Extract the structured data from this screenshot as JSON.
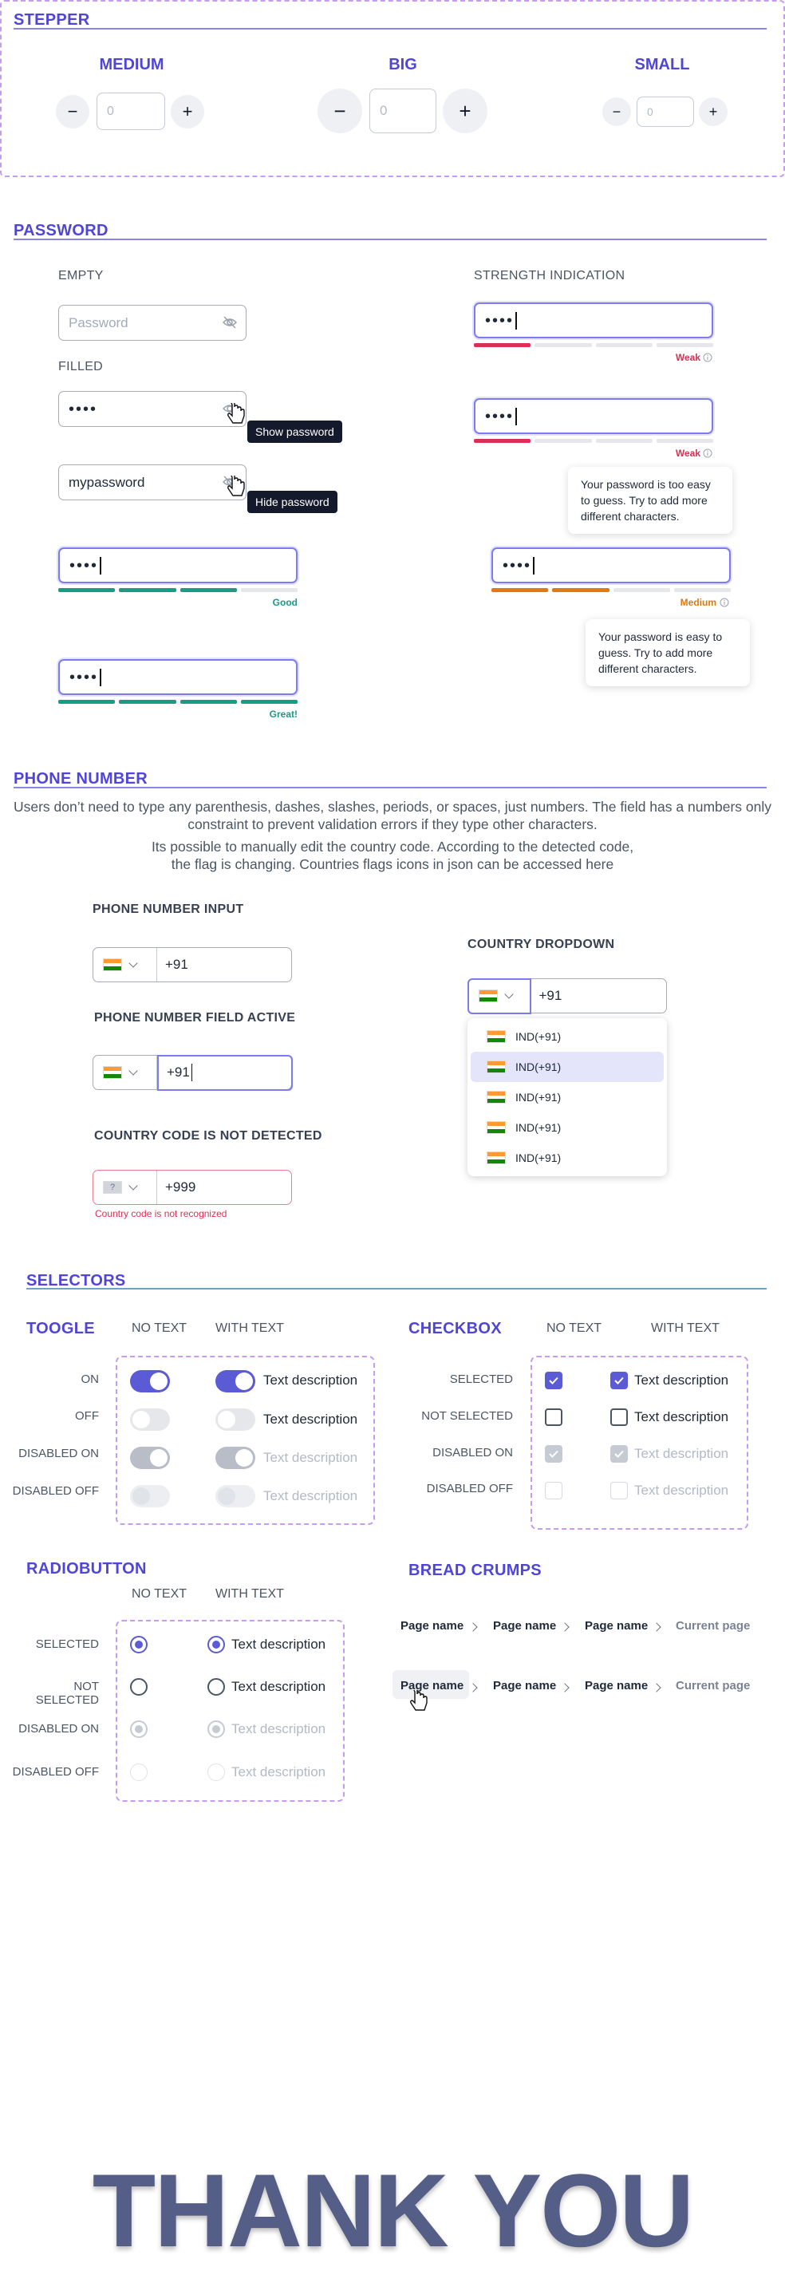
{
  "stepper": {
    "title": "STEPPER",
    "sizes": [
      {
        "label": "MEDIUM",
        "value": "0"
      },
      {
        "label": "BIG",
        "value": "0"
      },
      {
        "label": "SMALL",
        "value": "0"
      }
    ],
    "minus": "−",
    "plus": "+"
  },
  "password": {
    "title": "PASSWORD",
    "empty_label": "EMPTY",
    "filled_label": "FILLED",
    "strength_label": "STRENGTH INDICATION",
    "placeholder": "Password",
    "dots": "••••",
    "plain_value": "mypassword",
    "show_tip": "Show password",
    "hide_tip": "Hide password",
    "strengths": [
      {
        "label": "Weak",
        "color": "#dc2f55",
        "level": 1
      },
      {
        "label": "Medium",
        "color": "#e07a10",
        "level": 2
      },
      {
        "label": "Good",
        "color": "#199b84",
        "level": 3
      },
      {
        "label": "Great!",
        "color": "#199b84",
        "level": 4
      }
    ],
    "weak_hint": "Your password is too easy to guess. Try to add more different characters.",
    "medium_hint": "Your password is easy to guess. Try to add more different characters."
  },
  "phone": {
    "title": "PHONE NUMBER",
    "para1": "Users don’t need to type any parenthesis, dashes, slashes, periods, or spaces, just numbers. The field has a numbers only constraint to prevent validation errors if they type other characters.",
    "para2": "Its possible to manually edit the country code. According to the detected code, the flag is changing. Countries flags icons in json can be accessed here",
    "input_label": "PHONE NUMBER INPUT",
    "active_label": "PHONE NUMBER FIELD ACTIVE",
    "notdetected_label": "COUNTRY CODE IS NOT DETECTED",
    "dropdown_label": "COUNTRY DROPDOWN",
    "code": "+91",
    "bad_code": "+999",
    "unknown_flag": "?",
    "error": "Country code is not recognized",
    "options": [
      "IND(+91)",
      "IND(+91)",
      "IND(+91)",
      "IND(+91)",
      "IND(+91)"
    ]
  },
  "selectors": {
    "title": "SELECTORS",
    "toggle_title": "TOOGLE",
    "checkbox_title": "CHECKBOX",
    "radio_title": "RADIOBUTTON",
    "breadcrumbs_title": "BREAD CRUMPS",
    "no_text": "NO TEXT",
    "with_text": "WITH TEXT",
    "text": "Text description",
    "toggle_rows": [
      "ON",
      "OFF",
      "DISABLED ON",
      "DISABLED OFF"
    ],
    "check_rows": [
      "SELECTED",
      "NOT SELECTED",
      "DISABLED ON",
      "DISABLED OFF"
    ],
    "radio_rows": [
      "SELECTED",
      "NOT SELECTED",
      "DISABLED ON",
      "DISABLED OFF"
    ],
    "crumbs": [
      "Page name",
      "Page name",
      "Page name",
      "Current page"
    ]
  },
  "footer": {
    "thanks": "THANK YOU"
  },
  "colors": {
    "accent": "#5046d6",
    "primary": "#5b5bd6",
    "danger": "#dc2f55"
  }
}
